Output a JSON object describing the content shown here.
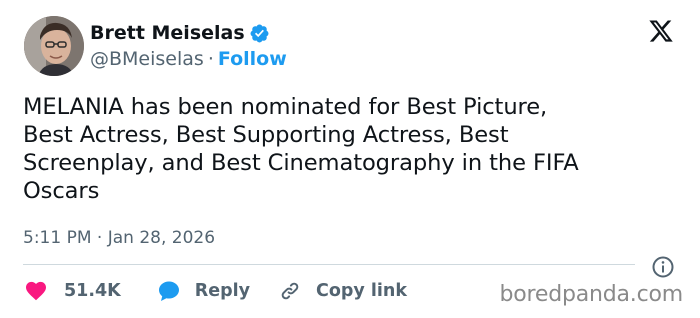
{
  "author": {
    "display_name": "Brett Meiselas",
    "handle": "@BMeiselas",
    "separator": "·",
    "follow_label": "Follow",
    "verified_color": "#1d9bf0"
  },
  "platform_icon": "x-logo-icon",
  "tweet": {
    "lines": [
      "MELANIA has been nominated for Best Picture,",
      "Best Actress, Best Supporting Actress, Best",
      "Screenplay, and Best Cinematography in the FIFA",
      "Oscars"
    ],
    "timestamp": "5:11 PM · Jan 28, 2026"
  },
  "actions": {
    "like_count": "51.4K",
    "like_color": "#f91880",
    "reply_label": "Reply",
    "reply_color": "#1d9bf0",
    "copy_link_label": "Copy link"
  },
  "watermark": "boredpanda.com"
}
